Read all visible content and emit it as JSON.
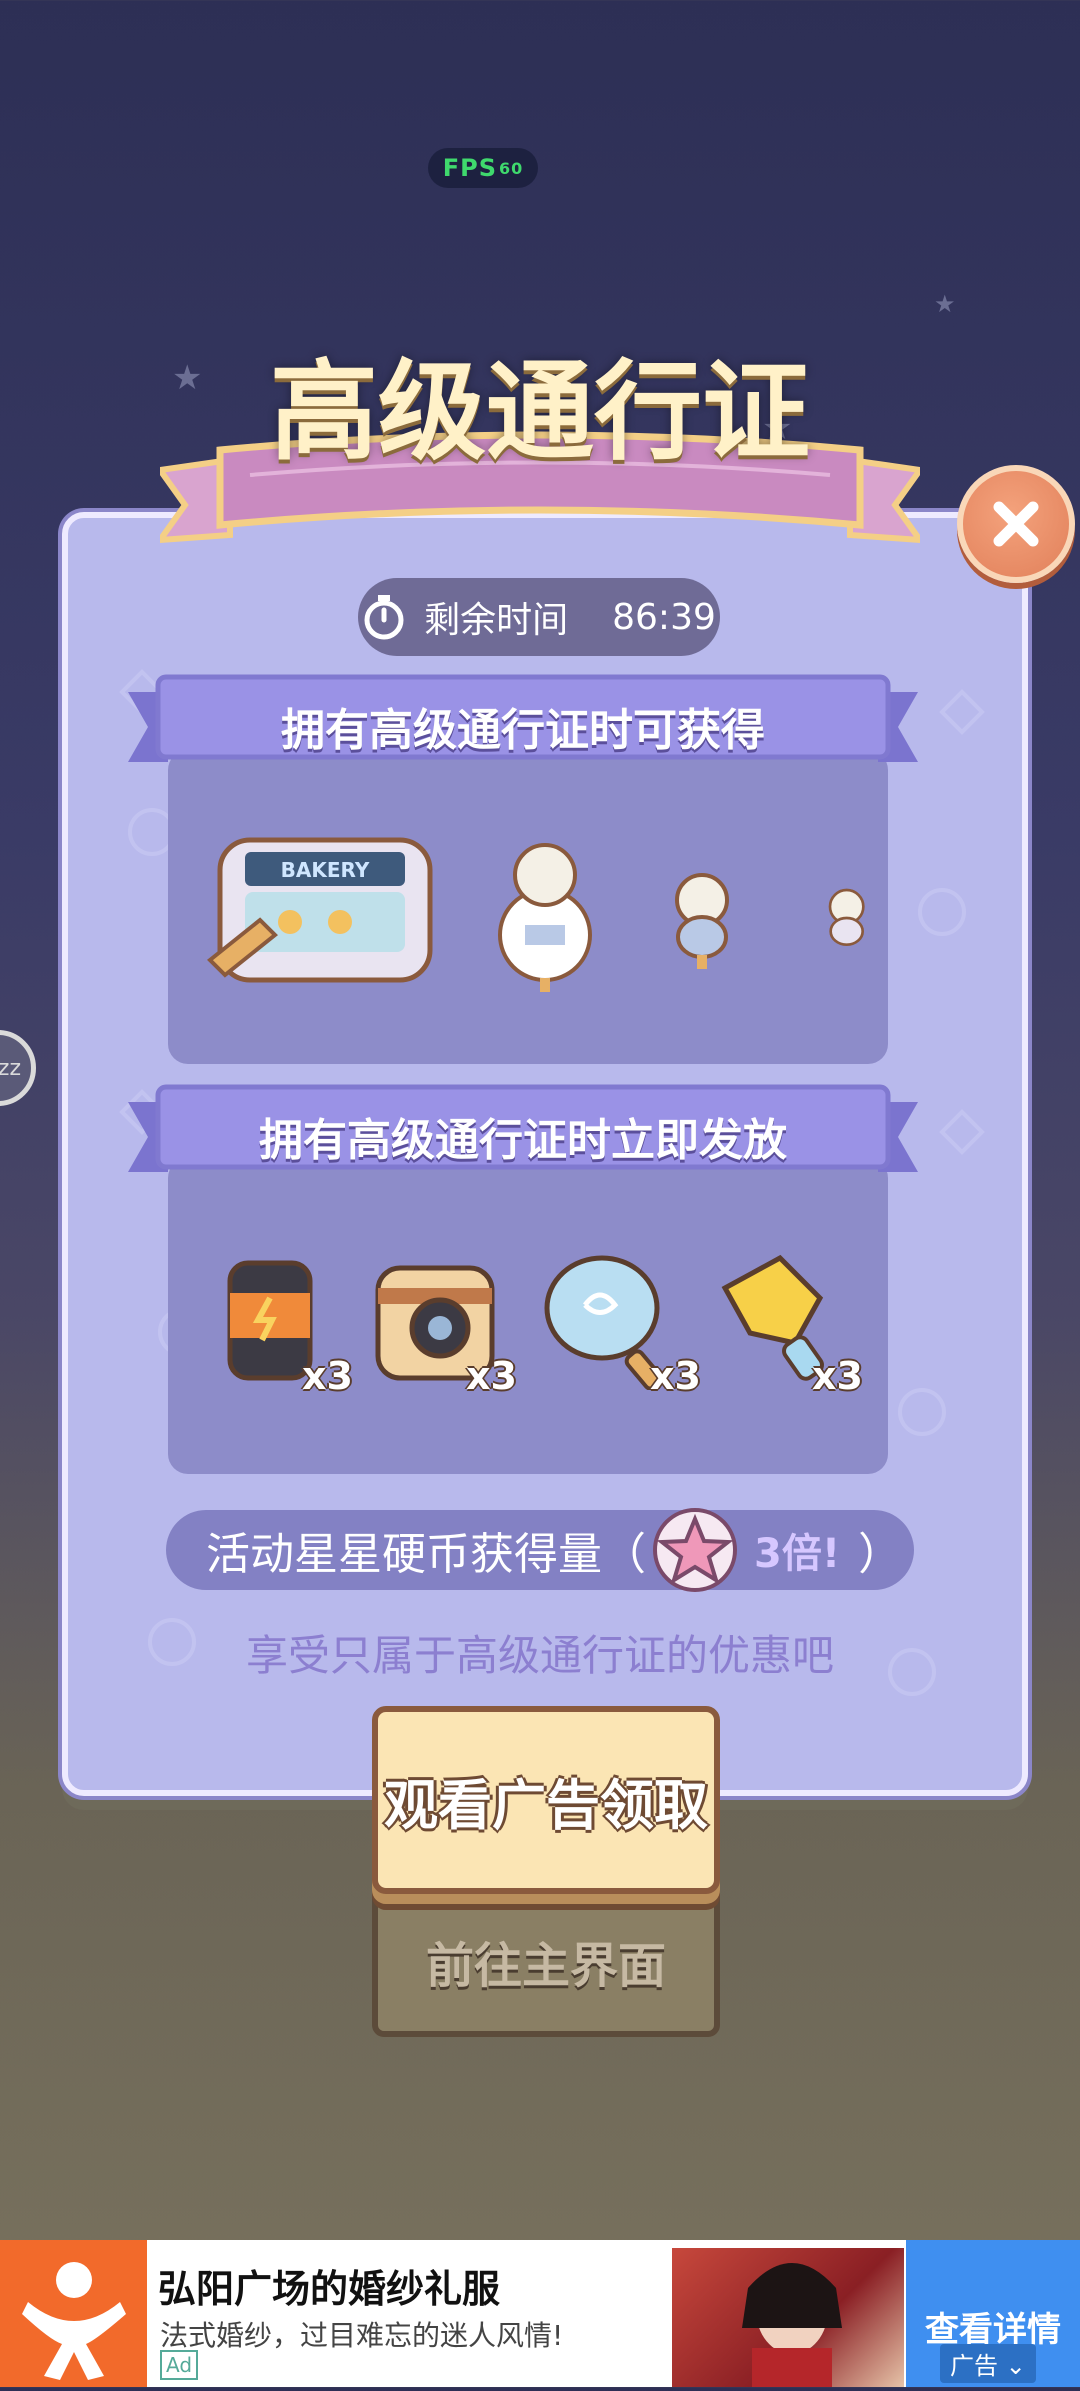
{
  "fps": {
    "label": "FPS",
    "value": "60"
  },
  "title": "高级通行证",
  "timer": {
    "label": "剩余时间",
    "value": "86:39"
  },
  "section1": {
    "label": "拥有高级通行证时可获得",
    "items": [
      {
        "name": "bakery-shop-icon",
        "text": "BAKERY"
      },
      {
        "name": "bear-statue-icon"
      },
      {
        "name": "cat-statue-icon"
      },
      {
        "name": "sheep-statue-icon"
      }
    ]
  },
  "section2": {
    "label": "拥有高级通行证时立即发放",
    "items": [
      {
        "name": "energy-can-icon",
        "qty": "x3"
      },
      {
        "name": "camera-icon",
        "qty": "x3"
      },
      {
        "name": "fan-icon",
        "qty": "x3"
      },
      {
        "name": "glove-icon",
        "qty": "x3"
      }
    ]
  },
  "coin_bonus": {
    "prefix": "活动星星硬币获得量（",
    "mult": "3倍!",
    "suffix": "）"
  },
  "subtitle": "享受只属于高级通行证的优惠吧",
  "buttons": {
    "watch_ad": "观看广告领取",
    "go_main": "前往主界面"
  },
  "side": {
    "label": "zz"
  },
  "ad": {
    "title": "弘阳广场的婚纱礼服",
    "desc": "法式婚纱，过目难忘的迷人风情!",
    "tag": "Ad",
    "cta": "查看详情",
    "badge": "广告"
  },
  "colors": {
    "panel": "#b8b9ec",
    "accent": "#fff1c8",
    "close": "#e1805a",
    "cta": "#3f8ff0"
  }
}
